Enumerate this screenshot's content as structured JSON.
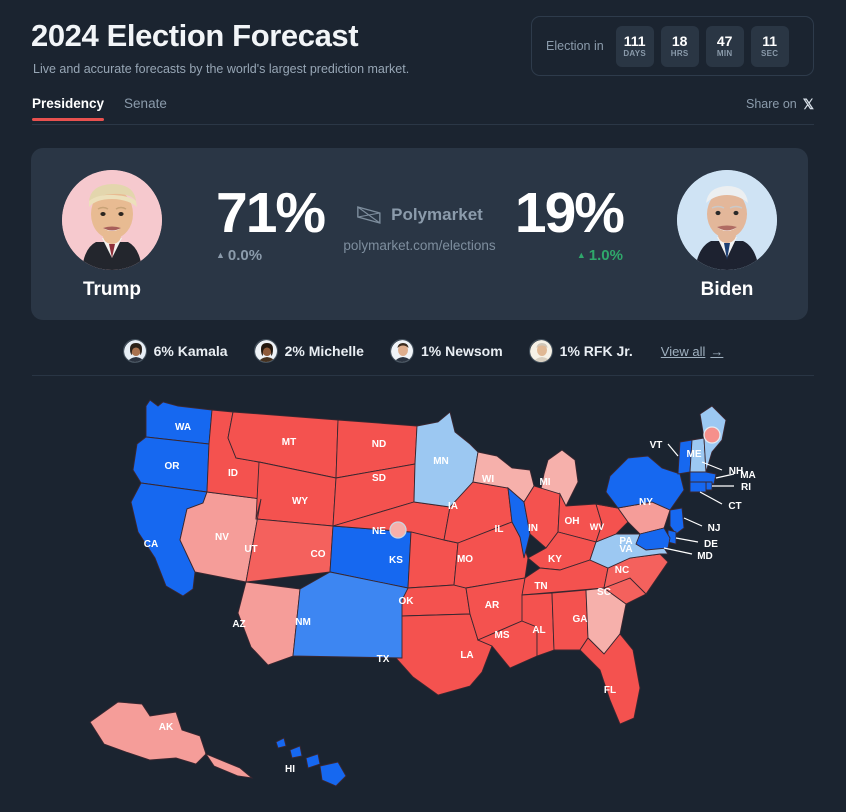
{
  "header": {
    "title": "2024 Election Forecast",
    "subtitle": "Live and accurate forecasts by the world's largest prediction market.",
    "countdown": {
      "label": "Election in",
      "units": [
        {
          "value": "111",
          "unit": "DAYS"
        },
        {
          "value": "18",
          "unit": "HRS"
        },
        {
          "value": "47",
          "unit": "MIN"
        },
        {
          "value": "11",
          "unit": "SEC"
        }
      ]
    }
  },
  "tabs": {
    "items": [
      {
        "label": "Presidency",
        "active": true
      },
      {
        "label": "Senate",
        "active": false
      }
    ],
    "share_label": "Share on",
    "share_icon": "x-logo-icon",
    "active_underline_color": "#e8514f"
  },
  "forecast": {
    "left": {
      "name": "Trump",
      "percent": "71%",
      "delta": "0.0%",
      "delta_direction": "up",
      "delta_color": "#8b9bab",
      "avatar_bg": "#f6c9ce"
    },
    "right": {
      "name": "Biden",
      "percent": "19%",
      "delta": "1.0%",
      "delta_direction": "up",
      "delta_color": "#2fa86b",
      "avatar_bg": "#cfe3f4"
    },
    "brand": {
      "name": "Polymarket",
      "url": "polymarket.com/elections",
      "logo_icon": "polymarket-bowtie-icon"
    }
  },
  "other_candidates": {
    "items": [
      {
        "label": "6% Kamala"
      },
      {
        "label": "2% Michelle"
      },
      {
        "label": "1% Newsom"
      },
      {
        "label": "1% RFK Jr."
      }
    ],
    "view_all_label": "View all",
    "view_all_arrow": "→"
  },
  "map": {
    "colors": {
      "background": "#1b2430",
      "strong_red": "#f4524f",
      "mid_red": "#f4615d",
      "light_red": "#f59d99",
      "pale_red": "#f6b0ab",
      "strong_blue": "#1668f0",
      "mid_blue": "#3d86f2",
      "light_blue": "#9cc8f2",
      "border": "#3a2730"
    },
    "states": [
      {
        "code": "WA",
        "lean": "strong_blue"
      },
      {
        "code": "OR",
        "lean": "strong_blue"
      },
      {
        "code": "CA",
        "lean": "strong_blue"
      },
      {
        "code": "NV",
        "lean": "light_red"
      },
      {
        "code": "ID",
        "lean": "strong_red"
      },
      {
        "code": "MT",
        "lean": "strong_red"
      },
      {
        "code": "WY",
        "lean": "strong_red"
      },
      {
        "code": "UT",
        "lean": "mid_red"
      },
      {
        "code": "AZ",
        "lean": "light_red"
      },
      {
        "code": "CO",
        "lean": "strong_blue"
      },
      {
        "code": "NM",
        "lean": "mid_blue"
      },
      {
        "code": "ND",
        "lean": "strong_red"
      },
      {
        "code": "SD",
        "lean": "strong_red"
      },
      {
        "code": "NE",
        "lean": "strong_red",
        "split_marker": true
      },
      {
        "code": "KS",
        "lean": "strong_red"
      },
      {
        "code": "OK",
        "lean": "strong_red"
      },
      {
        "code": "TX",
        "lean": "strong_red"
      },
      {
        "code": "MN",
        "lean": "light_blue"
      },
      {
        "code": "IA",
        "lean": "strong_red"
      },
      {
        "code": "MO",
        "lean": "strong_red"
      },
      {
        "code": "AR",
        "lean": "strong_red"
      },
      {
        "code": "LA",
        "lean": "strong_red"
      },
      {
        "code": "WI",
        "lean": "pale_red"
      },
      {
        "code": "IL",
        "lean": "strong_blue"
      },
      {
        "code": "MI",
        "lean": "pale_red"
      },
      {
        "code": "IN",
        "lean": "strong_red"
      },
      {
        "code": "OH",
        "lean": "strong_red"
      },
      {
        "code": "KY",
        "lean": "strong_red"
      },
      {
        "code": "TN",
        "lean": "strong_red"
      },
      {
        "code": "MS",
        "lean": "strong_red"
      },
      {
        "code": "AL",
        "lean": "strong_red"
      },
      {
        "code": "GA",
        "lean": "pale_red"
      },
      {
        "code": "FL",
        "lean": "strong_red"
      },
      {
        "code": "SC",
        "lean": "mid_red"
      },
      {
        "code": "NC",
        "lean": "mid_red"
      },
      {
        "code": "VA",
        "lean": "light_blue"
      },
      {
        "code": "WV",
        "lean": "strong_red"
      },
      {
        "code": "PA",
        "lean": "light_red"
      },
      {
        "code": "NY",
        "lean": "strong_blue"
      },
      {
        "code": "VT",
        "lean": "strong_blue"
      },
      {
        "code": "NH",
        "lean": "light_blue"
      },
      {
        "code": "ME",
        "lean": "light_blue",
        "split_marker": true
      },
      {
        "code": "MA",
        "lean": "strong_blue"
      },
      {
        "code": "RI",
        "lean": "strong_blue"
      },
      {
        "code": "CT",
        "lean": "strong_blue"
      },
      {
        "code": "NJ",
        "lean": "strong_blue"
      },
      {
        "code": "DE",
        "lean": "strong_blue"
      },
      {
        "code": "MD",
        "lean": "strong_blue"
      },
      {
        "code": "AK",
        "lean": "light_red"
      },
      {
        "code": "HI",
        "lean": "strong_blue"
      }
    ],
    "callout_labels": [
      "VT",
      "NH",
      "MA",
      "RI",
      "CT",
      "NJ",
      "DE",
      "MD"
    ]
  }
}
